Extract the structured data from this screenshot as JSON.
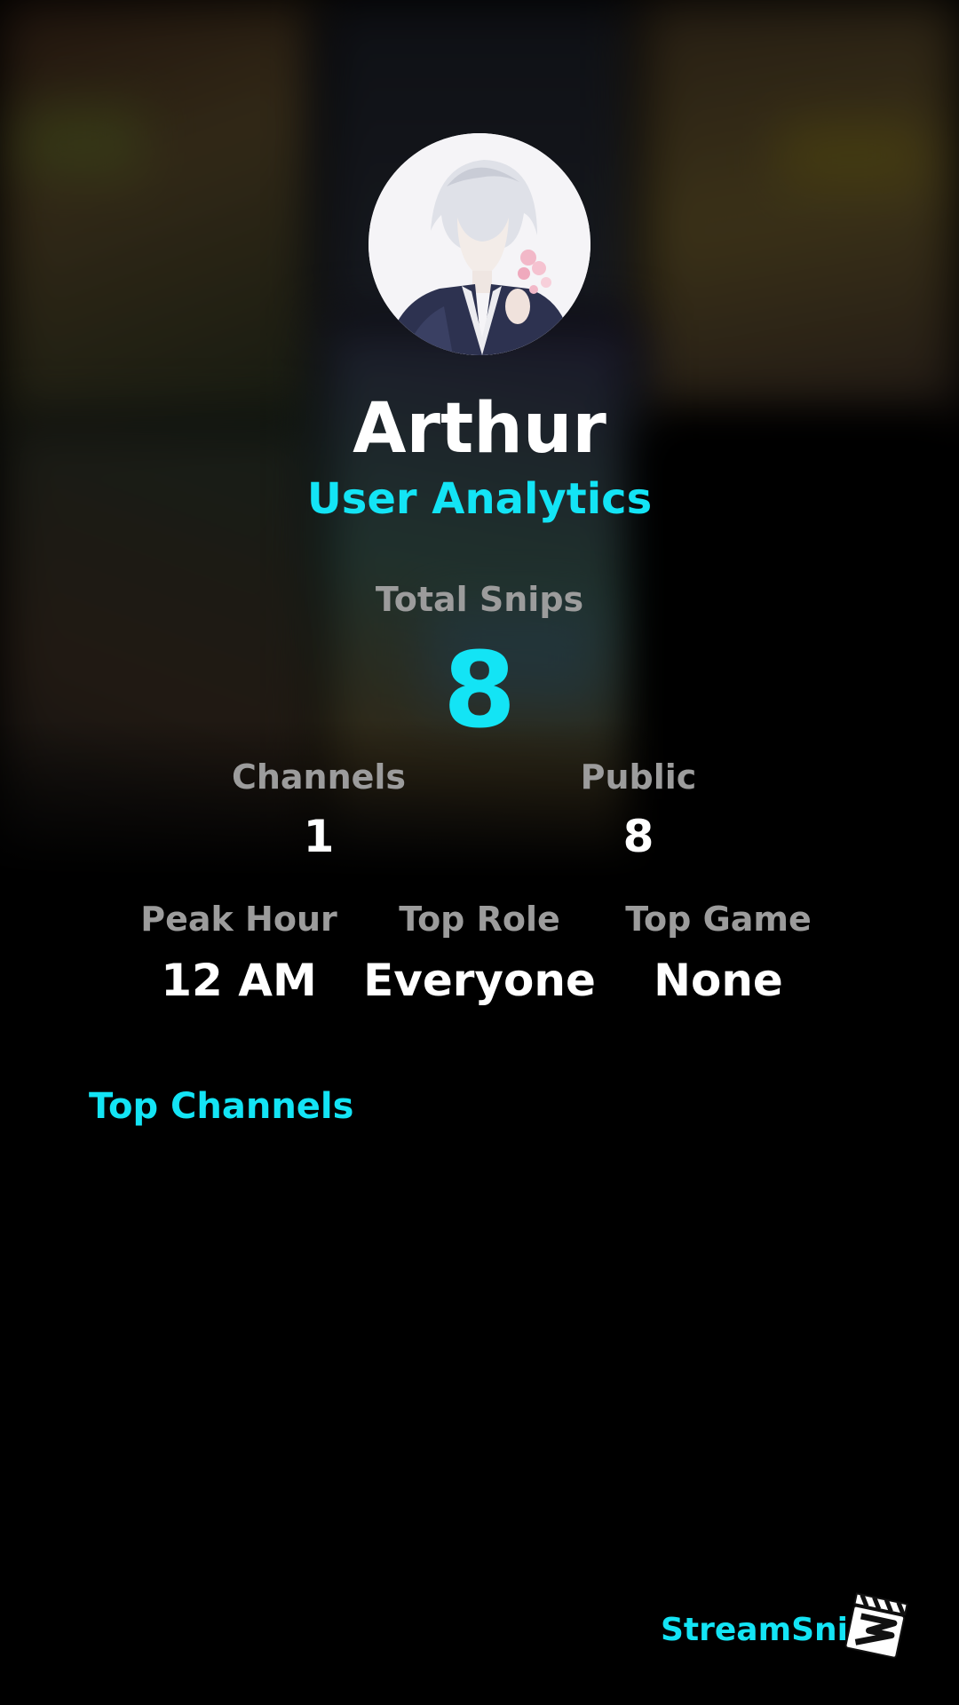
{
  "profile": {
    "username": "Arthur",
    "subtitle": "User Analytics"
  },
  "totals": {
    "label": "Total Snips",
    "value": "8"
  },
  "row1": [
    {
      "label": "Channels",
      "value": "1"
    },
    {
      "label": "Public",
      "value": "8"
    }
  ],
  "row2": [
    {
      "label": "Peak Hour",
      "value": "12 AM"
    },
    {
      "label": "Top Role",
      "value": "Everyone"
    },
    {
      "label": "Top Game",
      "value": "None"
    }
  ],
  "top_channels": {
    "title": "Top Channels"
  },
  "brand": {
    "name": "StreamSnip",
    "logo_icon": "clapperboard-logo-icon"
  },
  "colors": {
    "accent": "#13e4f5",
    "muted_label": "#9c9c9c",
    "background": "#000000",
    "value_text": "#ffffff"
  }
}
